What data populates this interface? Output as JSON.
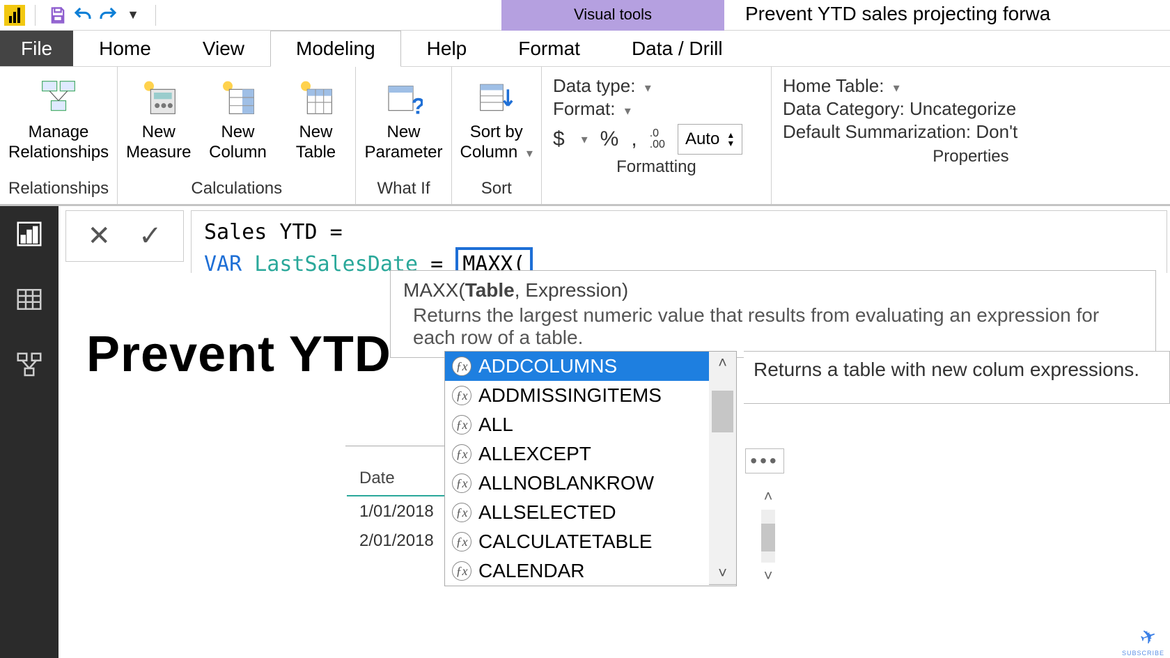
{
  "qat": {
    "contextual_tab": "Visual tools",
    "doc_title": "Prevent YTD sales projecting forwa"
  },
  "tabs": {
    "file": "File",
    "items": [
      "Home",
      "View",
      "Modeling",
      "Help",
      "Format",
      "Data / Drill"
    ],
    "active_index": 2
  },
  "ribbon": {
    "groups": {
      "relationships": {
        "label": "Relationships",
        "btn": "Manage\nRelationships"
      },
      "calculations": {
        "label": "Calculations",
        "btns": [
          "New\nMeasure",
          "New\nColumn",
          "New\nTable"
        ]
      },
      "whatif": {
        "label": "What If",
        "btn": "New\nParameter"
      },
      "sort": {
        "label": "Sort",
        "btn": "Sort by\nColumn"
      },
      "formatting": {
        "label": "Formatting",
        "data_type": "Data type:",
        "format": "Format:",
        "currency": "$",
        "percent": "%",
        "comma": ",",
        "decimals_icon": ".0\n.00",
        "auto": "Auto"
      },
      "properties": {
        "label": "Properties",
        "home_table": "Home Table:",
        "data_category": "Data Category: Uncategorize",
        "default_sum": "Default Summarization: Don't"
      }
    }
  },
  "formula": {
    "line1_prefix": "Sales YTD = ",
    "var_kw": "VAR",
    "var_name": "LastSalesDate",
    "eq": " = ",
    "fn": "MAXX(",
    "tooltip_sig_pre": "MAXX(",
    "tooltip_sig_bold": "Table",
    "tooltip_sig_post": ", Expression)",
    "tooltip_desc": "Returns the largest numeric value that results from evaluating an expression for each row of a table."
  },
  "intellisense": {
    "items": [
      "ADDCOLUMNS",
      "ADDMISSINGITEMS",
      "ALL",
      "ALLEXCEPT",
      "ALLNOBLANKROW",
      "ALLSELECTED",
      "CALCULATETABLE",
      "CALENDAR"
    ],
    "selected_index": 0,
    "desc": "Returns a table with new colum expressions."
  },
  "canvas": {
    "title": "Prevent YTD"
  },
  "mini_table": {
    "header": "Date",
    "rows": [
      "1/01/2018",
      "2/01/2018"
    ]
  },
  "subscribe": "SUBSCRIBE"
}
